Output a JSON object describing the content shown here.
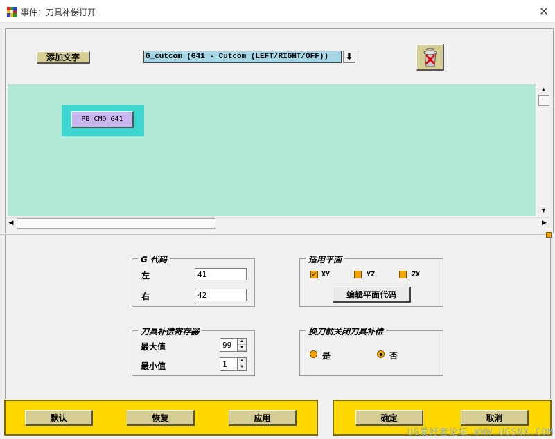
{
  "window": {
    "title": "事件：刀具补偿打开",
    "close_glyph": "✕",
    "icon": "app-grid-icon"
  },
  "toolbar": {
    "add_text_label": "添加文字",
    "event_select_value": "G_cutcom (G41 - Cutcom (LEFT/RIGHT/OFF))",
    "event_select_arrow": "⬇",
    "trash_icon": "trash-icon"
  },
  "canvas": {
    "block_label": "PB_CMD_G41"
  },
  "g_code": {
    "title": "G 代码",
    "left_label": "左",
    "left_value": "41",
    "right_label": "右",
    "right_value": "42"
  },
  "plane": {
    "title": "适用平面",
    "options": [
      {
        "label": "XY",
        "checked": true,
        "mark": "✓"
      },
      {
        "label": "YZ",
        "checked": false,
        "mark": ""
      },
      {
        "label": "ZX",
        "checked": false,
        "mark": ""
      }
    ],
    "edit_button": "编辑平面代码"
  },
  "register": {
    "title": "刀具补偿寄存器",
    "max_label": "最大值",
    "max_value": "99",
    "min_label": "最小值",
    "min_value": "1"
  },
  "tool_change": {
    "title": "换刀前关闭刀具补偿",
    "yes_label": "是",
    "no_label": "否",
    "selected": "no"
  },
  "buttons": {
    "default": "默认",
    "restore": "恢复",
    "apply": "应用",
    "ok": "确定",
    "cancel": "取消"
  },
  "watermark": "UG爱好者论坛 WWW.UGSNX.COM",
  "colors": {
    "canvas_bg": "#b0e8d3",
    "block_frame": "#3ed6d0",
    "block_button": "#c9b6ee",
    "select_bg": "#a6d5e6",
    "accent_orange": "#f3a400",
    "bar_yellow": "#ffd800",
    "button_khaki": "#d6cd95"
  }
}
